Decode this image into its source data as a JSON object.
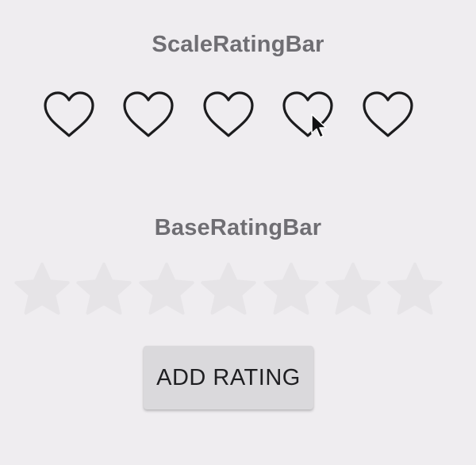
{
  "scale_rating_bar": {
    "title": "ScaleRatingBar",
    "icon": "heart-outline-icon",
    "total": 5,
    "rating": 0,
    "color": "#1c1c1e"
  },
  "base_rating_bar": {
    "title": "BaseRatingBar",
    "icon": "star-icon",
    "total": 7,
    "rating": 0,
    "empty_color": "#e6e4e7"
  },
  "add_button": {
    "label": "ADD RATING"
  },
  "colors": {
    "background": "#efedf0",
    "title_text": "#6f6e73",
    "button_bg": "#dad9dc"
  }
}
